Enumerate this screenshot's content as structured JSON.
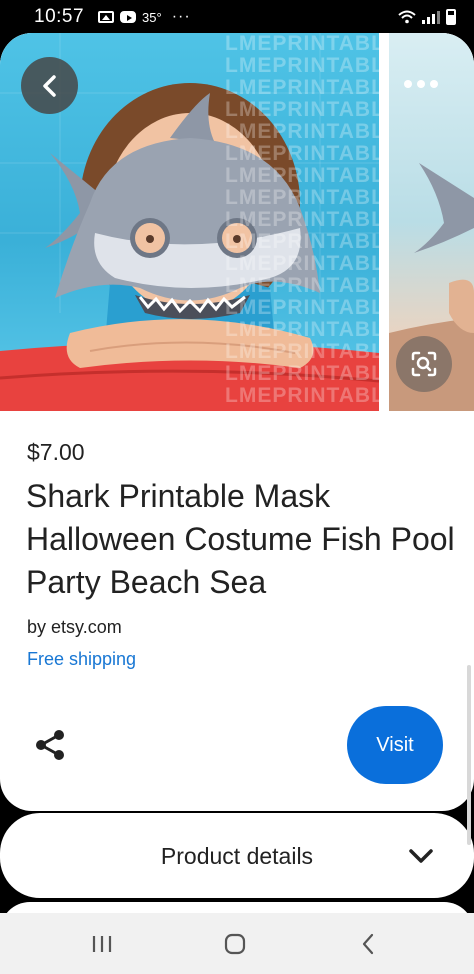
{
  "status_bar": {
    "time": "10:57",
    "temperature": "35°",
    "more_dots": "···"
  },
  "hero": {
    "watermark_text": "LMEPRINTABLES",
    "back_icon": "chevron-left-icon",
    "more_icon": "more-horizontal-icon",
    "lens_icon": "visual-search-icon"
  },
  "product": {
    "price": "$7.00",
    "title": "Shark Printable Mask Halloween Costume Fish Pool Party Beach Sea",
    "source": "by etsy.com",
    "shipping": "Free shipping",
    "share_icon": "share-icon",
    "visit_label": "Visit"
  },
  "details": {
    "label": "Product details",
    "chevron_icon": "chevron-down-icon"
  },
  "nav": {
    "recents_icon": "recents-icon",
    "home_icon": "home-icon",
    "back_icon": "back-icon"
  },
  "colors": {
    "visit_button": "#0a6fdb",
    "shipping_link": "#1877d4",
    "text": "#222222",
    "pool_water": "#3ab0d8"
  }
}
